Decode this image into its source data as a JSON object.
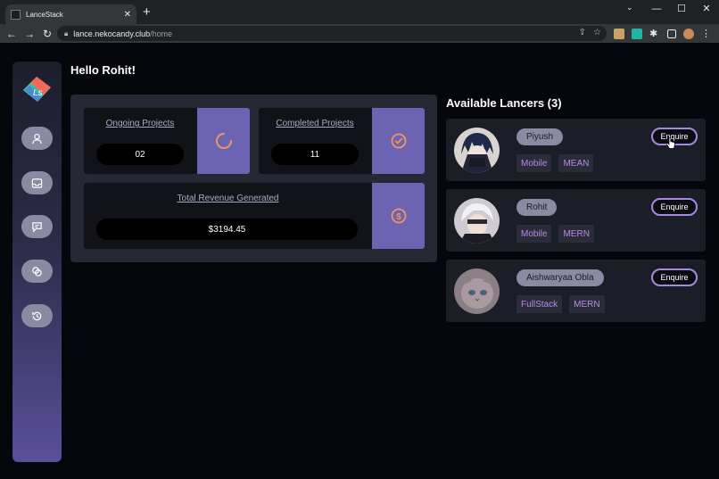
{
  "browser": {
    "tab_title": "LanceStack",
    "new_tab": "+",
    "close": "✕",
    "url_host": "lance.nekocandy.club",
    "url_path": "/home"
  },
  "greeting": "Hello Rohit!",
  "stats": {
    "ongoing_label": "Ongoing Projects",
    "ongoing_value": "02",
    "completed_label": "Completed Projects",
    "completed_value": "11",
    "revenue_label": "Total Revenue Generated",
    "revenue_value": "$3194.45"
  },
  "lancers": {
    "title": "Available Lancers (3)",
    "items": [
      {
        "name": "Piyush",
        "tags": [
          "Mobile",
          "MEAN"
        ],
        "action": "Enquire"
      },
      {
        "name": "Rohit",
        "tags": [
          "Mobile",
          "MERN"
        ],
        "action": "Enquire"
      },
      {
        "name": "Aishwaryaa Obla",
        "tags": [
          "FullStack",
          "MERN"
        ],
        "action": "Enquire"
      }
    ]
  },
  "sidebar_icons": [
    "user-icon",
    "inbox-icon",
    "chat-icon",
    "swap-icon",
    "history-icon"
  ],
  "colors": {
    "accent": "#6c63b3",
    "orange": "#f0955e",
    "tag_text": "#b98ae6",
    "background": "#06070d"
  }
}
